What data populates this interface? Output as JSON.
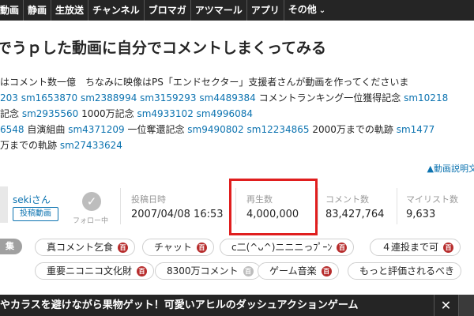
{
  "nav": {
    "items": [
      "動画",
      "静画",
      "生放送",
      "チャンネル",
      "ブロマガ",
      "アツマール",
      "アプリ"
    ],
    "more_label": "その他"
  },
  "video": {
    "title": "でうｐした動画に自分でコメントしまくってみる"
  },
  "description": {
    "line1": "はコメント数一億　ちなみに映像はPS「エンドセクター」支援者さんが動画を作ってくださいま",
    "line2": [
      {
        "type": "link",
        "text": "203"
      },
      {
        "type": "link",
        "text": "sm1653870"
      },
      {
        "type": "link",
        "text": "sm2388994"
      },
      {
        "type": "link",
        "text": "sm3159293"
      },
      {
        "type": "link",
        "text": "sm4489384"
      },
      {
        "type": "text",
        "text": "コメントランキング一位獲得記念"
      },
      {
        "type": "link",
        "text": "sm10218"
      }
    ],
    "line3": [
      {
        "type": "text",
        "text": "記念"
      },
      {
        "type": "link",
        "text": "sm2935560"
      },
      {
        "type": "text",
        "text": "1000万記念"
      },
      {
        "type": "link",
        "text": "sm4933102"
      },
      {
        "type": "link",
        "text": "sm4996084"
      }
    ],
    "line4": [
      {
        "type": "link",
        "text": "6548"
      },
      {
        "type": "text",
        "text": "自演組曲"
      },
      {
        "type": "link",
        "text": "sm4371209"
      },
      {
        "type": "text",
        "text": "一位奪還記念"
      },
      {
        "type": "link",
        "text": "sm9490802"
      },
      {
        "type": "link",
        "text": "sm12234865"
      },
      {
        "type": "text",
        "text": "2000万までの軌跡"
      },
      {
        "type": "link",
        "text": "sm1477"
      }
    ],
    "line5": [
      {
        "type": "text",
        "text": "万までの軌跡"
      },
      {
        "type": "link",
        "text": "sm27433624"
      }
    ],
    "more_link": "▲動画説明文"
  },
  "owner": {
    "name": "sekiさん",
    "badge": "投稿動画",
    "follow_label": "フォロー中"
  },
  "stats": {
    "posted_label": "投稿日時",
    "posted_value": "2007/04/08 16:53",
    "views_label": "再生数",
    "views_value": "4,000,000",
    "comments_label": "コメント数",
    "comments_value": "83,427,764",
    "mylist_label": "マイリスト数",
    "mylist_value": "9,633"
  },
  "tags": {
    "edit_label": "集",
    "row1": [
      "真コメント乞食",
      "チャット",
      "c二(^ᴗ^)ニニニっﾌﾟｰﾝ",
      "４連投まで可"
    ],
    "row2": [
      "重要ニコニコ文化財",
      "8300万コメント",
      "ゲーム音楽",
      "もっと評価されるべき"
    ]
  },
  "ad": {
    "text": "やカラスを避けながら果物ゲット！可愛いアヒルのダッシュアクションゲーム",
    "close_label": "✕"
  },
  "colors": {
    "nav_bg": "#252525",
    "link": "#0c73b0",
    "highlight": "#e01e1e",
    "dic_icon": "#b72c2c"
  }
}
